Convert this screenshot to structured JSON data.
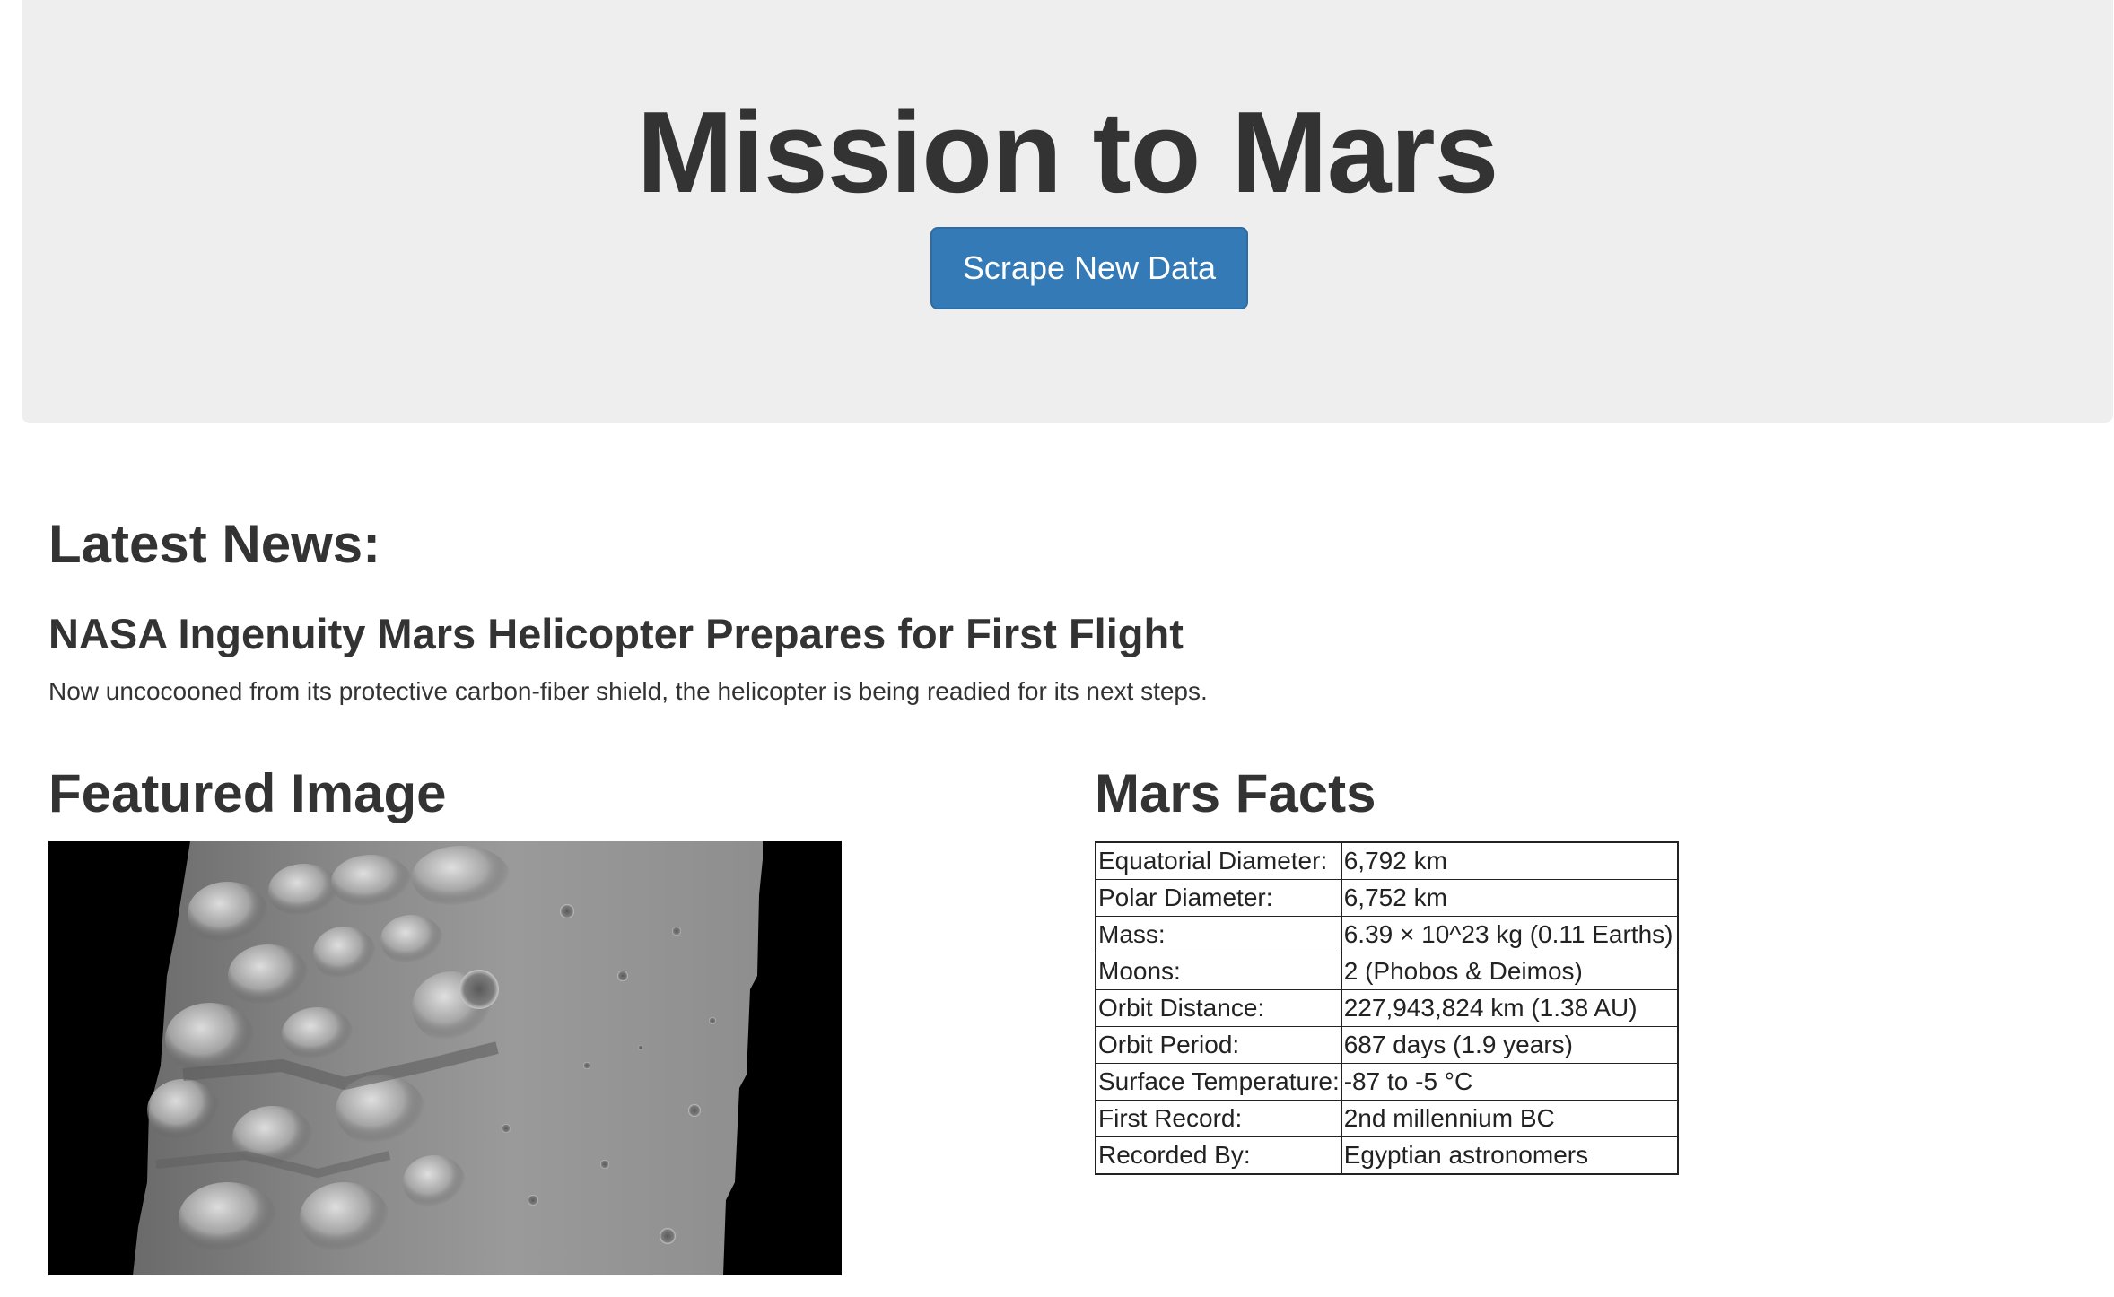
{
  "header": {
    "title": "Mission to Mars",
    "scrape_button_label": "Scrape New Data"
  },
  "news": {
    "heading": "Latest News:",
    "title": "NASA Ingenuity Mars Helicopter Prepares for First Flight",
    "teaser": "Now uncocooned from its protective carbon-fiber shield, the helicopter is being readied for its next steps."
  },
  "featured": {
    "heading": "Featured Image",
    "image_icon": "mars-surface-image"
  },
  "facts": {
    "heading": "Mars Facts",
    "rows": [
      {
        "label": "Equatorial Diameter:",
        "value": "6,792 km"
      },
      {
        "label": "Polar Diameter:",
        "value": "6,752 km"
      },
      {
        "label": "Mass:",
        "value": "6.39 × 10^23 kg (0.11 Earths)"
      },
      {
        "label": "Moons:",
        "value": "2 (Phobos & Deimos)"
      },
      {
        "label": "Orbit Distance:",
        "value": "227,943,824 km (1.38 AU)"
      },
      {
        "label": "Orbit Period:",
        "value": "687 days (1.9 years)"
      },
      {
        "label": "Surface Temperature:",
        "value": "-87 to -5 °C"
      },
      {
        "label": "First Record:",
        "value": "2nd millennium BC"
      },
      {
        "label": "Recorded By:",
        "value": "Egyptian astronomers"
      }
    ]
  },
  "colors": {
    "jumbotron_bg": "#eeeeee",
    "button_bg": "#337ab7",
    "text": "#333333"
  }
}
